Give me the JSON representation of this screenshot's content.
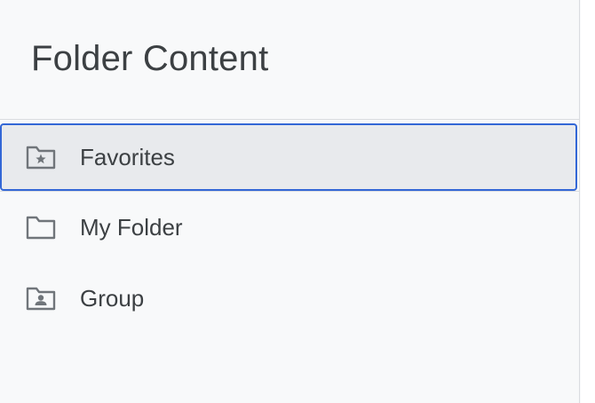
{
  "panel": {
    "title": "Folder Content"
  },
  "folders": [
    {
      "label": "Favorites",
      "icon": "star-folder-icon",
      "selected": true
    },
    {
      "label": "My Folder",
      "icon": "folder-icon",
      "selected": false
    },
    {
      "label": "Group",
      "icon": "shared-folder-icon",
      "selected": false
    }
  ],
  "colors": {
    "background": "#f8f9fa",
    "text": "#3c4043",
    "icon": "#70757a",
    "selected_bg": "#e8eaed",
    "selected_border": "#3367d6",
    "divider": "#dadce0"
  }
}
